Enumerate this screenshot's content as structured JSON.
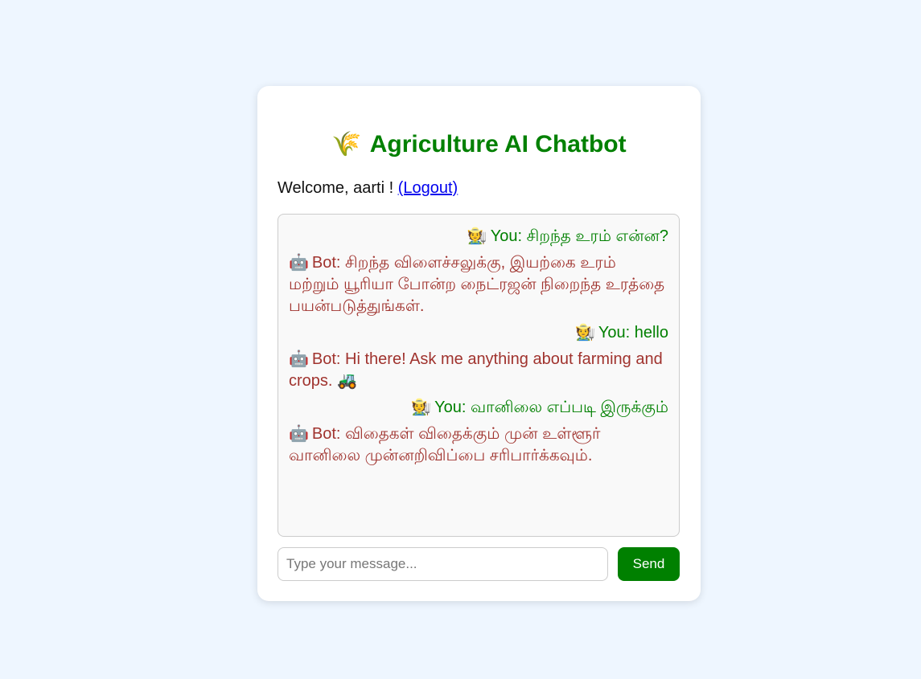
{
  "header": {
    "title_icon": "🌾",
    "title_icon_name": "wheat-icon",
    "title": "Agriculture AI Chatbot"
  },
  "welcome": {
    "text": "Welcome, aarti ! ",
    "logout_label": "(Logout)"
  },
  "chat": {
    "messages": [
      {
        "sender": "user",
        "avatar": "🧑‍🌾",
        "text": "You: சிறந்த உரம் என்ன?"
      },
      {
        "sender": "bot",
        "avatar": "🤖",
        "text": "Bot: சிறந்த விளைச்சலுக்கு, இயற்கை உரம் மற்றும் யூரியா போன்ற நைட்ரஜன் நிறைந்த உரத்தை பயன்படுத்துங்கள்."
      },
      {
        "sender": "user",
        "avatar": "🧑‍🌾",
        "text": "You: hello"
      },
      {
        "sender": "bot",
        "avatar": "🤖",
        "text": "Bot: Hi there! Ask me anything about farming and crops. 🚜"
      },
      {
        "sender": "user",
        "avatar": "🧑‍🌾",
        "text": "You: வானிலை எப்படி இருக்கும்"
      },
      {
        "sender": "bot",
        "avatar": "🤖",
        "text": "Bot: விதைகள் விதைக்கும் முன் உள்ளூர் வானிலை முன்னறிவிப்பை சரிபார்க்கவும்."
      }
    ]
  },
  "composer": {
    "placeholder": "Type your message...",
    "value": "",
    "send_label": "Send"
  },
  "colors": {
    "accent": "#008000",
    "bot_text": "#a0332e",
    "background": "#eef6ff",
    "link": "#0000ee"
  }
}
